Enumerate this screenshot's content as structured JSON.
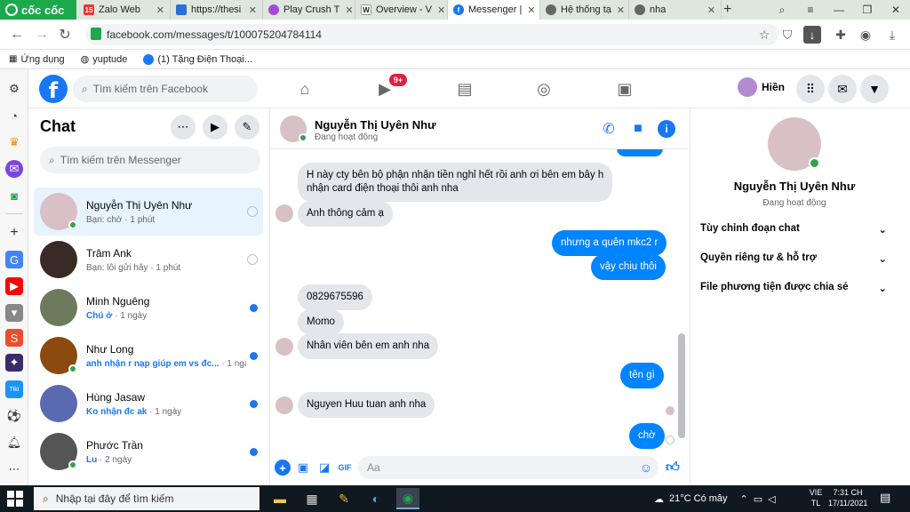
{
  "browser": {
    "brand": "cốc cốc",
    "tabs": [
      {
        "title": "Zalo Web",
        "fav": "15"
      },
      {
        "title": "https://thesi",
        "fav": ""
      },
      {
        "title": "Play Crush T",
        "fav": ""
      },
      {
        "title": "Overview - V",
        "fav": "W"
      },
      {
        "title": "Messenger |",
        "fav": "f"
      },
      {
        "title": "Hệ thống tạ",
        "fav": ""
      },
      {
        "title": "nha",
        "fav": ""
      }
    ],
    "url": "facebook.com/messages/t/100075204784114",
    "bookmarks": [
      "Ứng dụng",
      "yuptude",
      "(1) Tặng Điện Thoại..."
    ]
  },
  "fb": {
    "search_placeholder": "Tìm kiếm trên Facebook",
    "badge": "9+",
    "profile_name": "Hiền"
  },
  "chat": {
    "title": "Chat",
    "search_placeholder": "Tìm kiếm trên Messenger",
    "conversations": [
      {
        "name": "Nguyễn Thị Uyên Như",
        "preview": "Bạn: chờ",
        "time": "· 1 phút",
        "color": "#d9c0c6"
      },
      {
        "name": "Trâm Ank",
        "preview": "Bạn: lỗi gửi hây",
        "time": "· 1 phút",
        "color": "#3a2a26"
      },
      {
        "name": "Minh Nguêng",
        "preview": "Chú ở",
        "time": "· 1 ngày",
        "color": "#6e7a5c"
      },
      {
        "name": "Như Long",
        "preview": "anh nhận r nạp giúp em vs đc...",
        "time": "· 1 ngày",
        "color": "#8a4a10"
      },
      {
        "name": "Hùng Jasaw",
        "preview": "Ko nhận đc ak",
        "time": "· 1 ngày",
        "color": "#5a6ab0"
      },
      {
        "name": "Phước Trần",
        "preview": "Lu",
        "time": "· 2 ngày",
        "color": "#555555"
      }
    ]
  },
  "conversation": {
    "name": "Nguyễn Thị Uyên Như",
    "status": "Đang hoạt động",
    "messages": [
      {
        "text": "H này cty bên bộ phận nhận tiền nghỉ hết rồi anh ơi bên em bây h",
        "text2": "nhận card điện thoại thôi anh nha"
      },
      {
        "text": "Anh thông cảm ạ"
      },
      {
        "text": "nhưng a quên mkc2 r"
      },
      {
        "text": "vậy chịu thôi"
      },
      {
        "text": "0829675596"
      },
      {
        "text": "Momo"
      },
      {
        "text": "Nhân viên bên em anh nha"
      },
      {
        "text": "tên gì"
      },
      {
        "text": "Nguyen Huu tuan anh nha"
      },
      {
        "text": "chờ"
      }
    ],
    "composer_placeholder": "Aa"
  },
  "panel": {
    "name": "Nguyễn Thị Uyên Như",
    "status": "Đang hoạt động",
    "options": [
      "Tùy chỉnh đoạn chat",
      "Quyền riêng tư & hỗ trợ",
      "File phương tiện được chia sẻ"
    ]
  },
  "taskbar": {
    "search_placeholder": "Nhập tại đây để tìm kiếm",
    "weather": "21°C Có mây",
    "lang1": "VIE",
    "lang2": "TL",
    "time": "7:31 CH",
    "date": "17/11/2021"
  }
}
